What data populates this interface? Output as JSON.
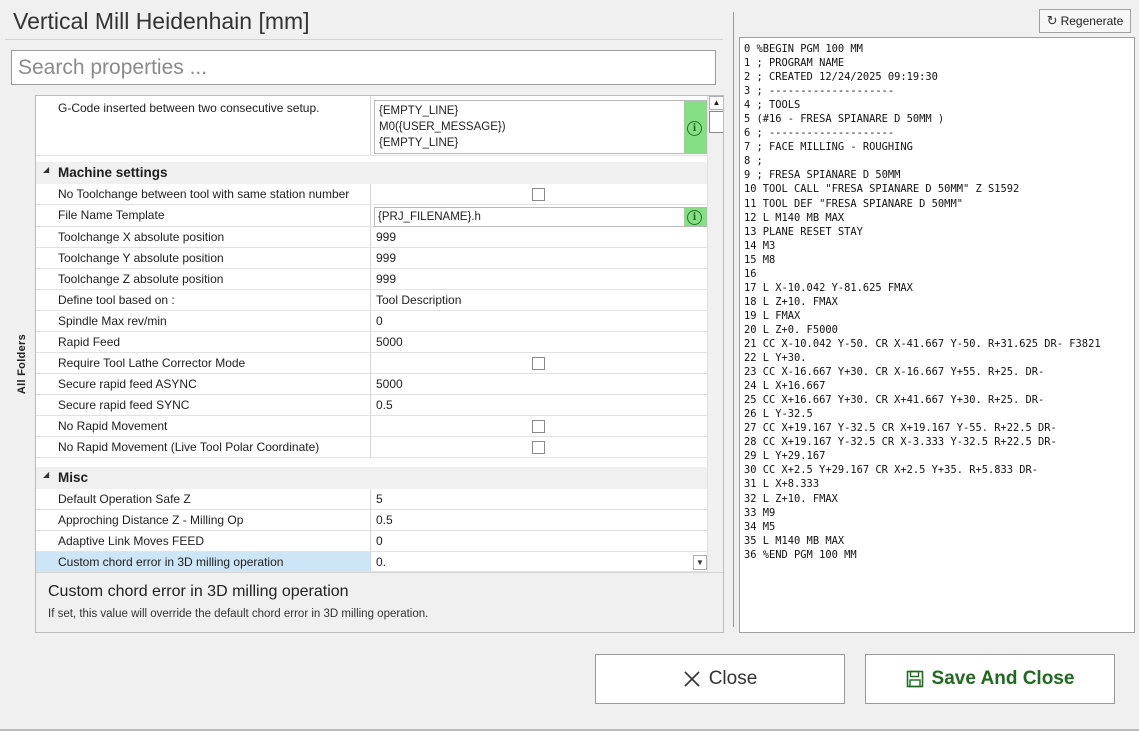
{
  "window": {
    "title": "Vertical Mill Heidenhain [mm]"
  },
  "search": {
    "placeholder": "Search properties ..."
  },
  "side_tab": {
    "label": "All Folders"
  },
  "grid": {
    "gcode_between_setup": {
      "label": "G-Code inserted between two consecutive setup.",
      "lines": [
        "{EMPTY_LINE}",
        "M0({USER_MESSAGE})",
        "{EMPTY_LINE}"
      ]
    },
    "categories": {
      "machine_settings": "Machine settings",
      "misc": "Misc"
    },
    "machine_rows": [
      {
        "label": "No Toolchange between tool with same station number",
        "value": "",
        "checkbox": true,
        "checked": false
      },
      {
        "label": "File Name Template",
        "value": "{PRJ_FILENAME}.h"
      },
      {
        "label": "Toolchange X absolute position",
        "value": "999"
      },
      {
        "label": "Toolchange Y absolute position",
        "value": "999"
      },
      {
        "label": "Toolchange Z absolute position",
        "value": "999"
      },
      {
        "label": "Define tool based on :",
        "value": "Tool Description"
      },
      {
        "label": "Spindle Max rev/min",
        "value": "0"
      },
      {
        "label": "Rapid Feed",
        "value": "5000"
      },
      {
        "label": "Require Tool Lathe Corrector Mode",
        "value": "",
        "checkbox": true,
        "checked": false
      },
      {
        "label": "Secure rapid feed ASYNC",
        "value": "5000"
      },
      {
        "label": "Secure rapid feed SYNC",
        "value": "0.5"
      },
      {
        "label": "No Rapid Movement",
        "value": "",
        "checkbox": true,
        "checked": false
      },
      {
        "label": "No Rapid Movement (Live Tool Polar Coordinate)",
        "value": "",
        "checkbox": true,
        "checked": false
      }
    ],
    "misc_rows": [
      {
        "label": "Default Operation Safe Z",
        "value": "5"
      },
      {
        "label": "Approching Distance Z - Milling Op",
        "value": "0.5"
      },
      {
        "label": "Adaptive Link Moves FEED",
        "value": "0"
      },
      {
        "label": "Custom chord error in 3D milling operation",
        "value": "0.",
        "selected": true
      }
    ]
  },
  "description": {
    "title": "Custom chord error in 3D milling operation",
    "text": "If set, this value will override the default chord error in 3D milling operation."
  },
  "toolbar": {
    "regenerate_label": "Regenerate"
  },
  "code_lines": [
    "0 %BEGIN PGM 100 MM",
    "1 ; PROGRAM NAME",
    "2 ; CREATED 12/24/2025 09:19:30",
    "3 ; --------------------",
    "4 ; TOOLS",
    "5 (#16 - FRESA SPIANARE D 50MM )",
    "6 ; --------------------",
    "7 ; FACE MILLING - ROUGHING",
    "8 ;",
    "9 ; FRESA SPIANARE D 50MM",
    "10 TOOL CALL \"FRESA SPIANARE D 50MM\" Z S1592",
    "11 TOOL DEF \"FRESA SPIANARE D 50MM\"",
    "12 L M140 MB MAX",
    "13 PLANE RESET STAY",
    "14 M3",
    "15 M8",
    "16",
    "17 L X-10.042 Y-81.625 FMAX",
    "18 L Z+10. FMAX",
    "19 L FMAX",
    "20 L Z+0. F5000",
    "21 CC X-10.042 Y-50. CR X-41.667 Y-50. R+31.625 DR- F3821",
    "22 L Y+30.",
    "23 CC X-16.667 Y+30. CR X-16.667 Y+55. R+25. DR-",
    "24 L X+16.667",
    "25 CC X+16.667 Y+30. CR X+41.667 Y+30. R+25. DR-",
    "26 L Y-32.5",
    "27 CC X+19.167 Y-32.5 CR X+19.167 Y-55. R+22.5 DR-",
    "28 CC X+19.167 Y-32.5 CR X-3.333 Y-32.5 R+22.5 DR-",
    "29 L Y+29.167",
    "30 CC X+2.5 Y+29.167 CR X+2.5 Y+35. R+5.833 DR-",
    "31 L X+8.333",
    "32 L Z+10. FMAX",
    "33 M9",
    "34 M5",
    "35 L M140 MB MAX",
    "36 %END PGM 100 MM"
  ],
  "buttons": {
    "close_label": "Close",
    "save_label": "Save And Close"
  },
  "colors": {
    "accent_green": "#85e085",
    "selection": "#cde6f7",
    "save_text": "#1f6a1f"
  }
}
